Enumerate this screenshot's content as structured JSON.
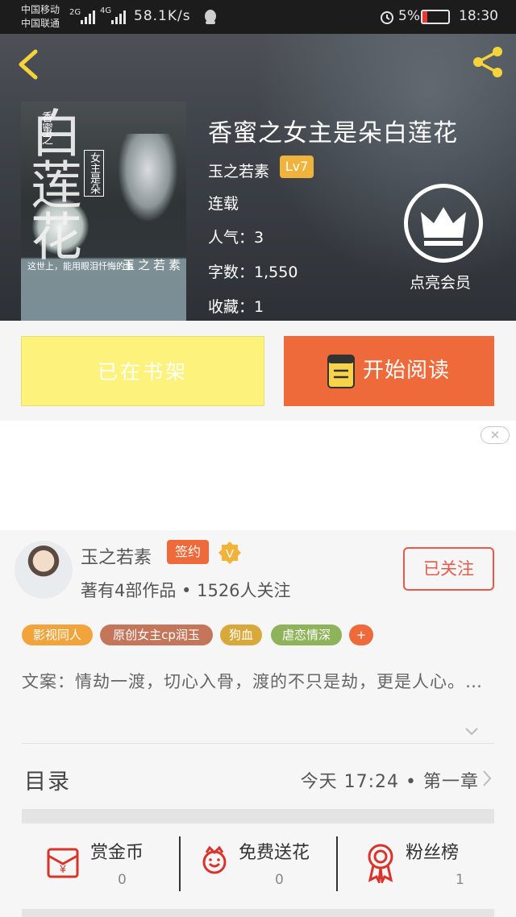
{
  "status_bar": {
    "carrier1": "中国移动",
    "carrier2": "中国联通",
    "net1": "2G",
    "net2": "4G",
    "speed": "58.1K/s",
    "battery": "5%",
    "time": "18:30"
  },
  "book": {
    "title": "香蜜之女主是朵白莲花",
    "author": "玉之若素",
    "level": "Lv7",
    "status": "连载",
    "popularity_label": "人气：",
    "popularity": "3",
    "words_label": "字数：",
    "words": "1,550",
    "favorites_label": "收藏：",
    "favorites": "1",
    "vip_label": "点亮会员",
    "cover_title_big": "白莲花",
    "cover_title_small": "香蜜之",
    "cover_subtitle": "女主是朵",
    "cover_author": "玉之若素",
    "cover_slogan": "这世上，能用眼泪忏悔的事"
  },
  "buttons": {
    "shelf": "已在书架",
    "read": "开始阅读"
  },
  "ad": {
    "close": "✕"
  },
  "author_card": {
    "name": "玉之若素",
    "sign_badge": "签约",
    "v_badge": "V",
    "stats": "著有4部作品 • 1526人关注",
    "follow": "已关注"
  },
  "tags": [
    {
      "label": "影视同人",
      "color": "#f0a43a"
    },
    {
      "label": "原创女主cp润玉",
      "color": "#c4765a"
    },
    {
      "label": "狗血",
      "color": "#d9a83a"
    },
    {
      "label": "虐恋情深",
      "color": "#8fb35a"
    },
    {
      "label": "+",
      "color": "#ee6a3a"
    }
  ],
  "description": "文案：情劫一渡，切心入骨，渡的不只是劫，更是人心。…",
  "toc": {
    "label": "目录",
    "info": "今天  17:24  •  第一章"
  },
  "actions": [
    {
      "label": "赏金币",
      "count": "0",
      "icon": "coin-icon"
    },
    {
      "label": "免费送花",
      "count": "0",
      "icon": "flower-icon"
    },
    {
      "label": "粉丝榜",
      "count": "1",
      "icon": "medal-icon"
    }
  ],
  "colors": {
    "accent": "#ee6a3a",
    "shelf_yellow": "#fdf27b",
    "level_badge": "#f0b33c",
    "follow_red": "#e65a4a"
  }
}
